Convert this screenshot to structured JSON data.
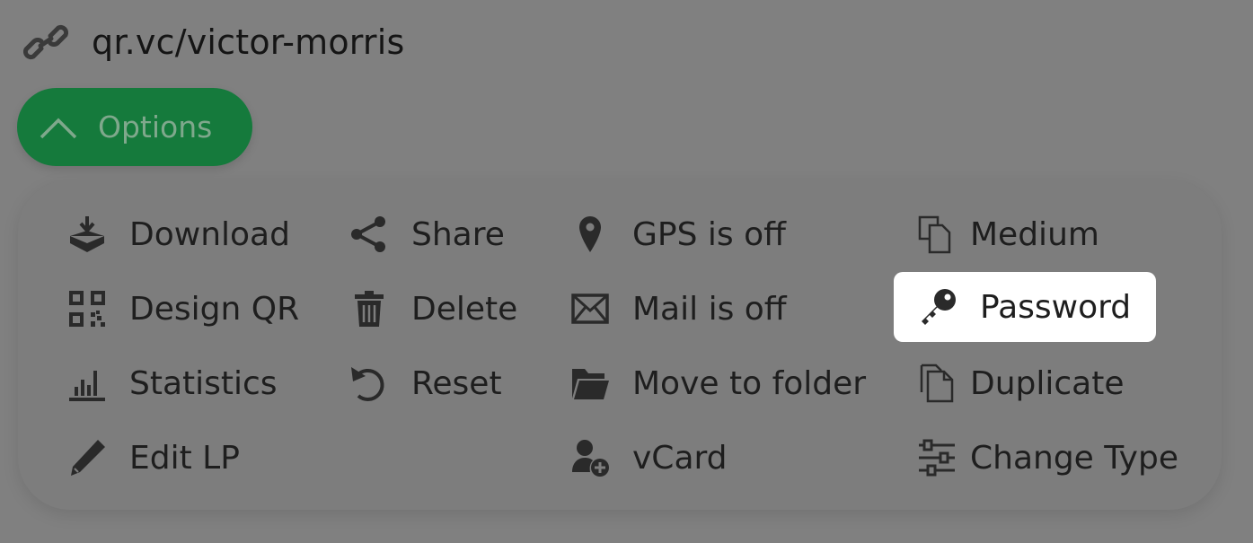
{
  "link": {
    "url": "qr.vc/victor-morris"
  },
  "options_button": {
    "label": "Options"
  },
  "menu": {
    "download": "Download",
    "share": "Share",
    "gps": "GPS is off",
    "size": "Medium",
    "design_qr": "Design QR",
    "delete": "Delete",
    "mail": "Mail is off",
    "password": "Password",
    "statistics": "Statistics",
    "reset": "Reset",
    "move_to_folder": "Move to folder",
    "duplicate": "Duplicate",
    "edit_lp": "Edit LP",
    "vcard": "vCard",
    "change_type": "Change Type"
  },
  "colors": {
    "background": "#808080",
    "options_button": "#157a3c",
    "highlight": "#ffffff"
  }
}
